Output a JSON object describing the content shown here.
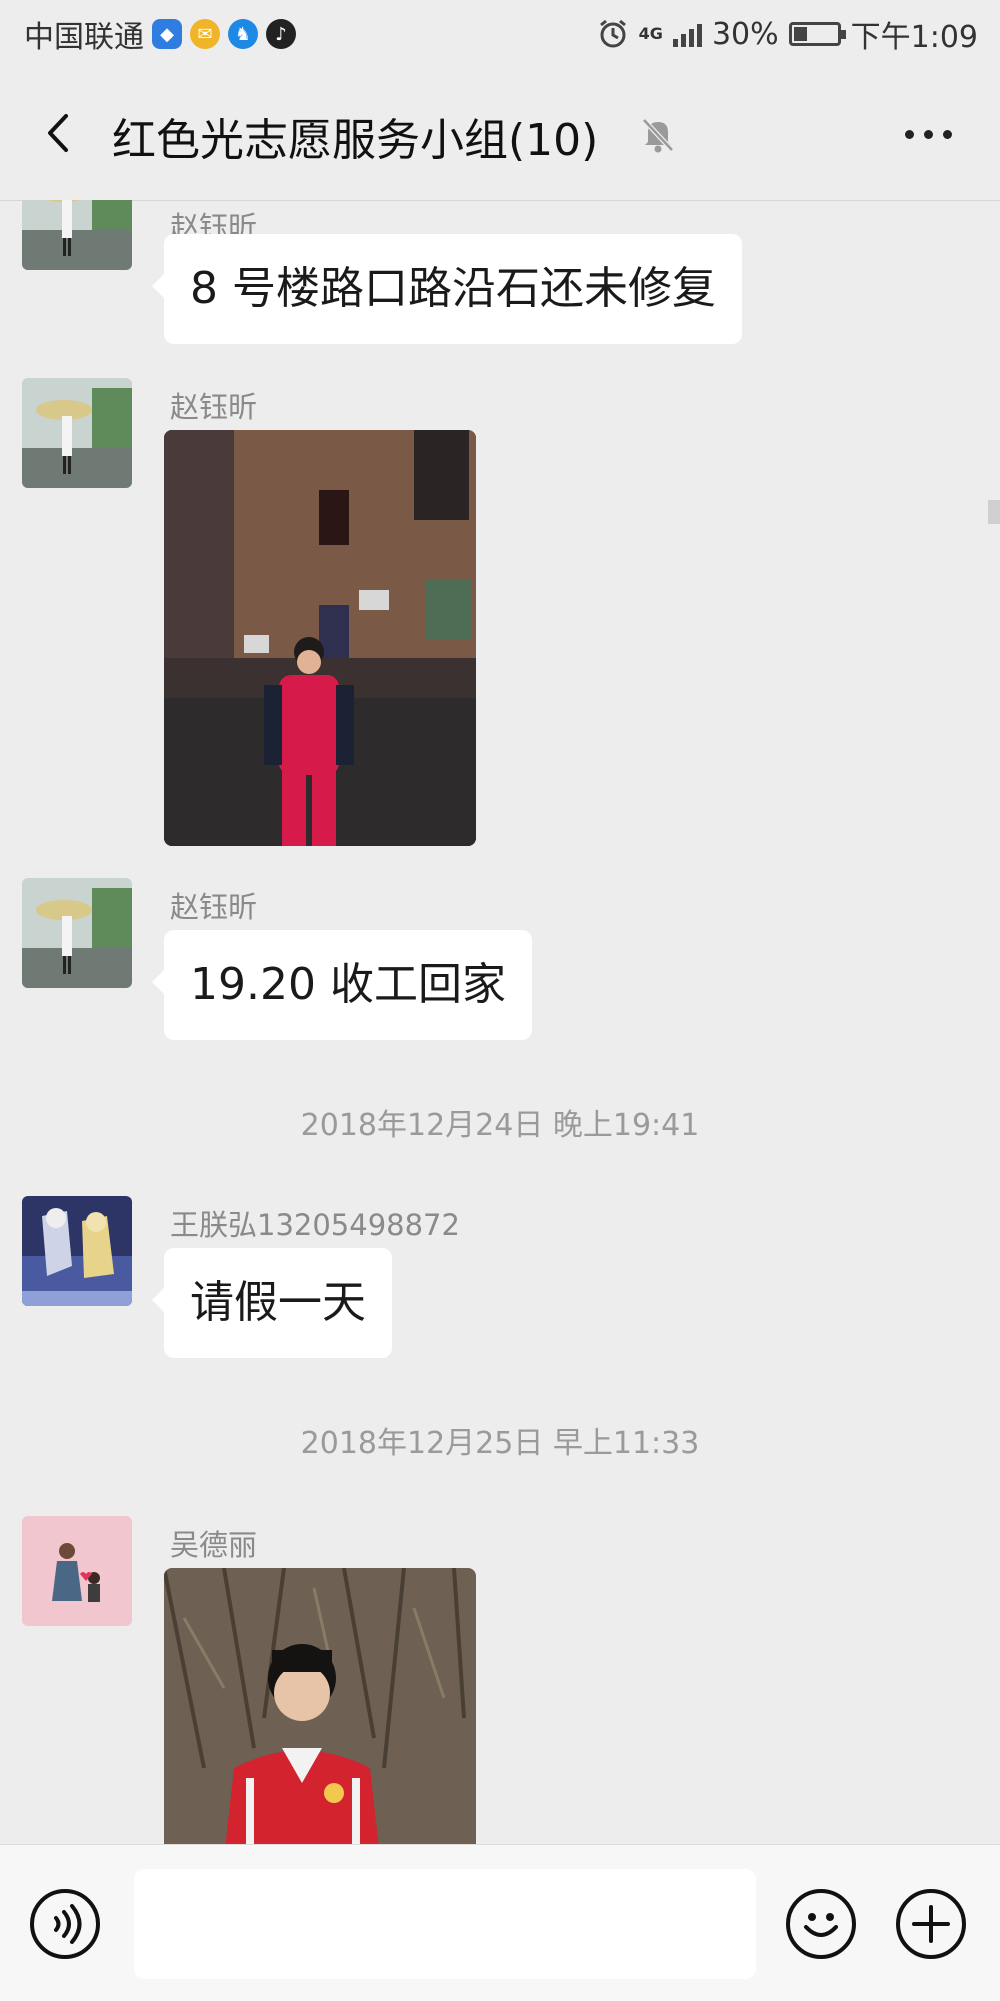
{
  "status_bar": {
    "carrier": "中国联通",
    "network": "4G",
    "battery": "30%",
    "battery_level": 0.3,
    "time": "下午1:09"
  },
  "header": {
    "title": "红色光志愿服务小组(10)",
    "back_icon": "chevron-left-icon",
    "mute_icon": "bell-off-icon",
    "more_icon": "more-dots-icon"
  },
  "messages": [
    {
      "sender": "赵钰昕",
      "type": "text",
      "text": "8 号楼路口路沿石还未修复"
    },
    {
      "sender": "赵钰昕",
      "type": "image"
    },
    {
      "sender": "赵钰昕",
      "type": "text",
      "text": "19.20 收工回家"
    },
    {
      "type": "timestamp",
      "text": "2018年12月24日 晚上19:41"
    },
    {
      "sender": "王朕弘13205498872",
      "type": "text",
      "text": "请假一天"
    },
    {
      "type": "timestamp",
      "text": "2018年12月25日 早上11:33"
    },
    {
      "sender": "吴德丽",
      "type": "image"
    }
  ],
  "input_bar": {
    "voice_icon": "voice-icon",
    "input_value": "",
    "emoji_icon": "emoji-icon",
    "plus_icon": "plus-icon"
  },
  "colors": {
    "background": "#ededed",
    "bubble": "#ffffff",
    "meta_text": "#8a8a8a"
  }
}
